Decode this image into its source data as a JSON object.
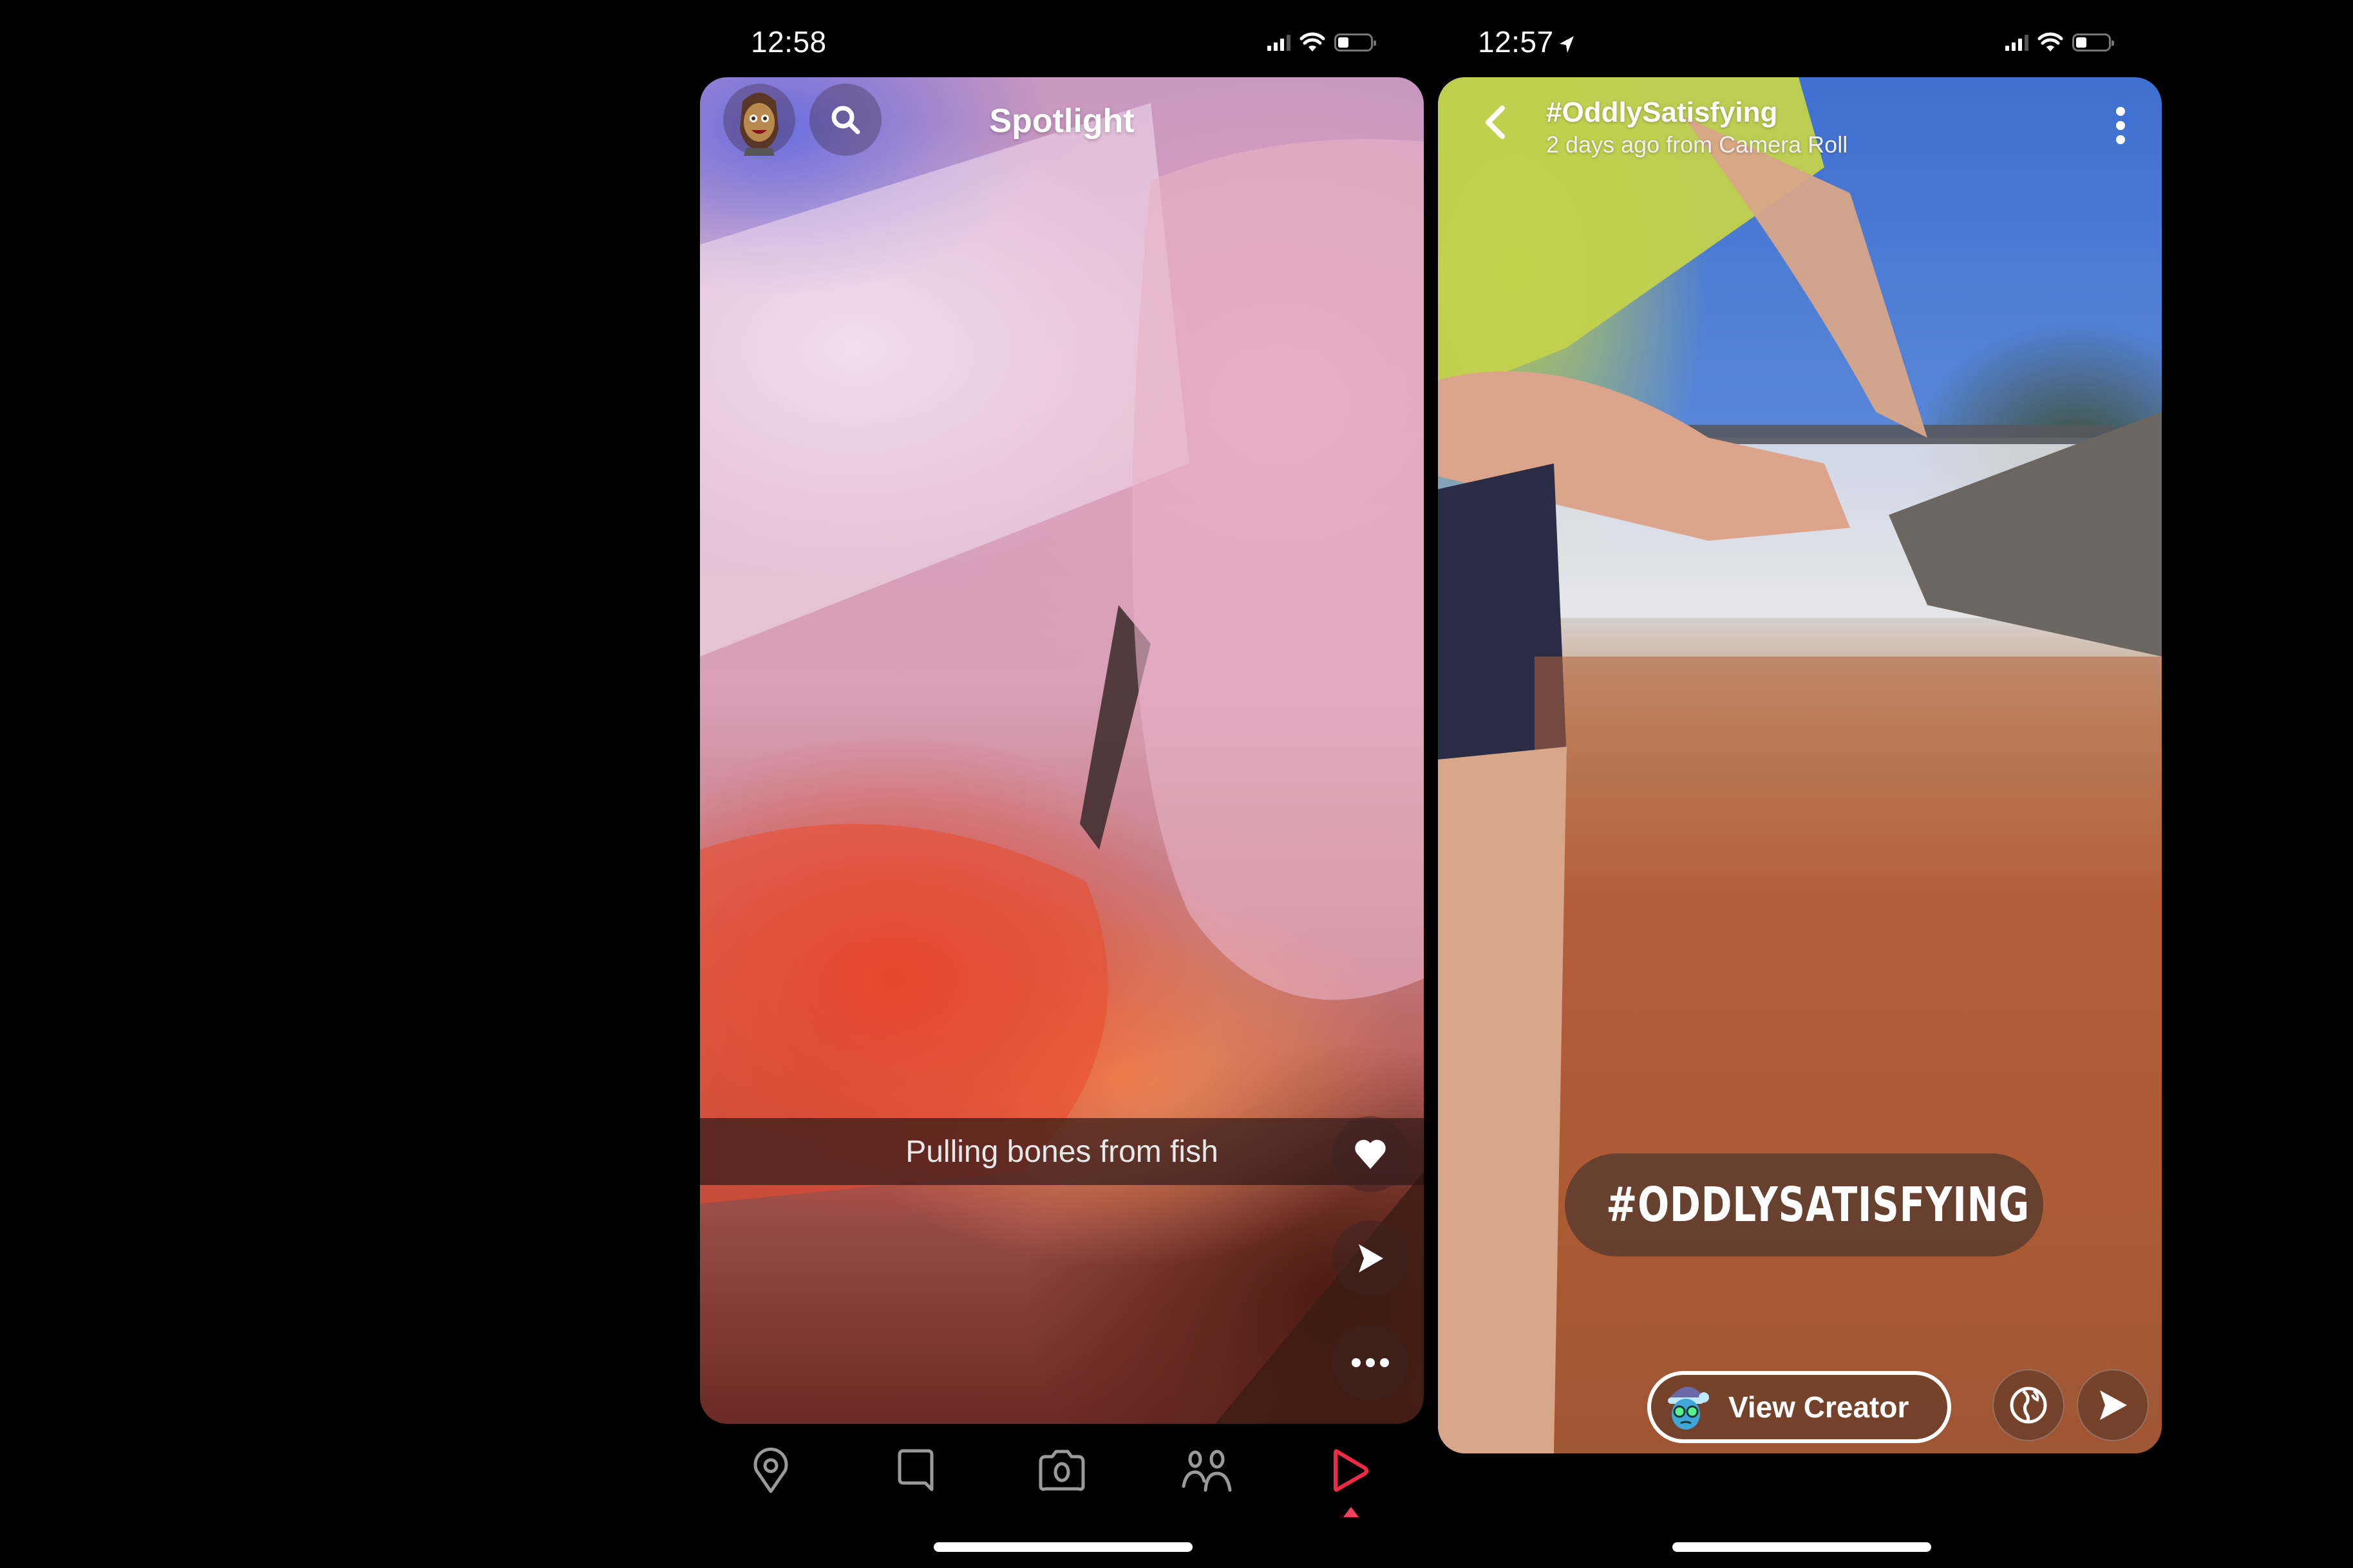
{
  "left_screen": {
    "status_bar": {
      "time": "12:58",
      "signal_bars": 3,
      "signal_total": 4,
      "battery_level": 0.3
    },
    "header": {
      "title": "Spotlight",
      "avatar_icon": "bitmoji-avatar",
      "search_icon": "search-icon"
    },
    "video": {
      "caption": "Pulling bones from fish",
      "actions": [
        {
          "name": "like",
          "icon": "heart-icon"
        },
        {
          "name": "share",
          "icon": "send-arrow-icon"
        },
        {
          "name": "more",
          "icon": "more-dots-icon"
        }
      ]
    },
    "bottom_nav": {
      "items": [
        {
          "name": "map",
          "icon": "map-pin-icon",
          "active": false
        },
        {
          "name": "chat",
          "icon": "chat-bubble-icon",
          "active": false
        },
        {
          "name": "camera",
          "icon": "camera-icon",
          "active": false
        },
        {
          "name": "stories",
          "icon": "friends-icon",
          "active": false
        },
        {
          "name": "spotlight",
          "icon": "play-icon",
          "active": true
        }
      ],
      "active_color": "#ee2b47",
      "inactive_color": "#9a9a9a"
    }
  },
  "right_screen": {
    "status_bar": {
      "time": "12:57",
      "location_active": true,
      "signal_bars": 3,
      "signal_total": 4,
      "battery_level": 0.3
    },
    "header": {
      "title": "#OddlySatisfying",
      "subtitle": "2 days ago from Camera Roll",
      "back_icon": "chevron-left-icon",
      "menu_icon": "vertical-dots-icon"
    },
    "hashtag_sticker": {
      "text": "#ODDLYSATISFYING",
      "icon": "globe-icon",
      "icon_color": "#f2e21a"
    },
    "view_creator": {
      "label": "View Creator",
      "avatar_icon": "creator-bitmoji"
    },
    "actions": [
      {
        "name": "public",
        "icon": "globe-icon"
      },
      {
        "name": "share",
        "icon": "send-arrow-icon"
      }
    ]
  }
}
